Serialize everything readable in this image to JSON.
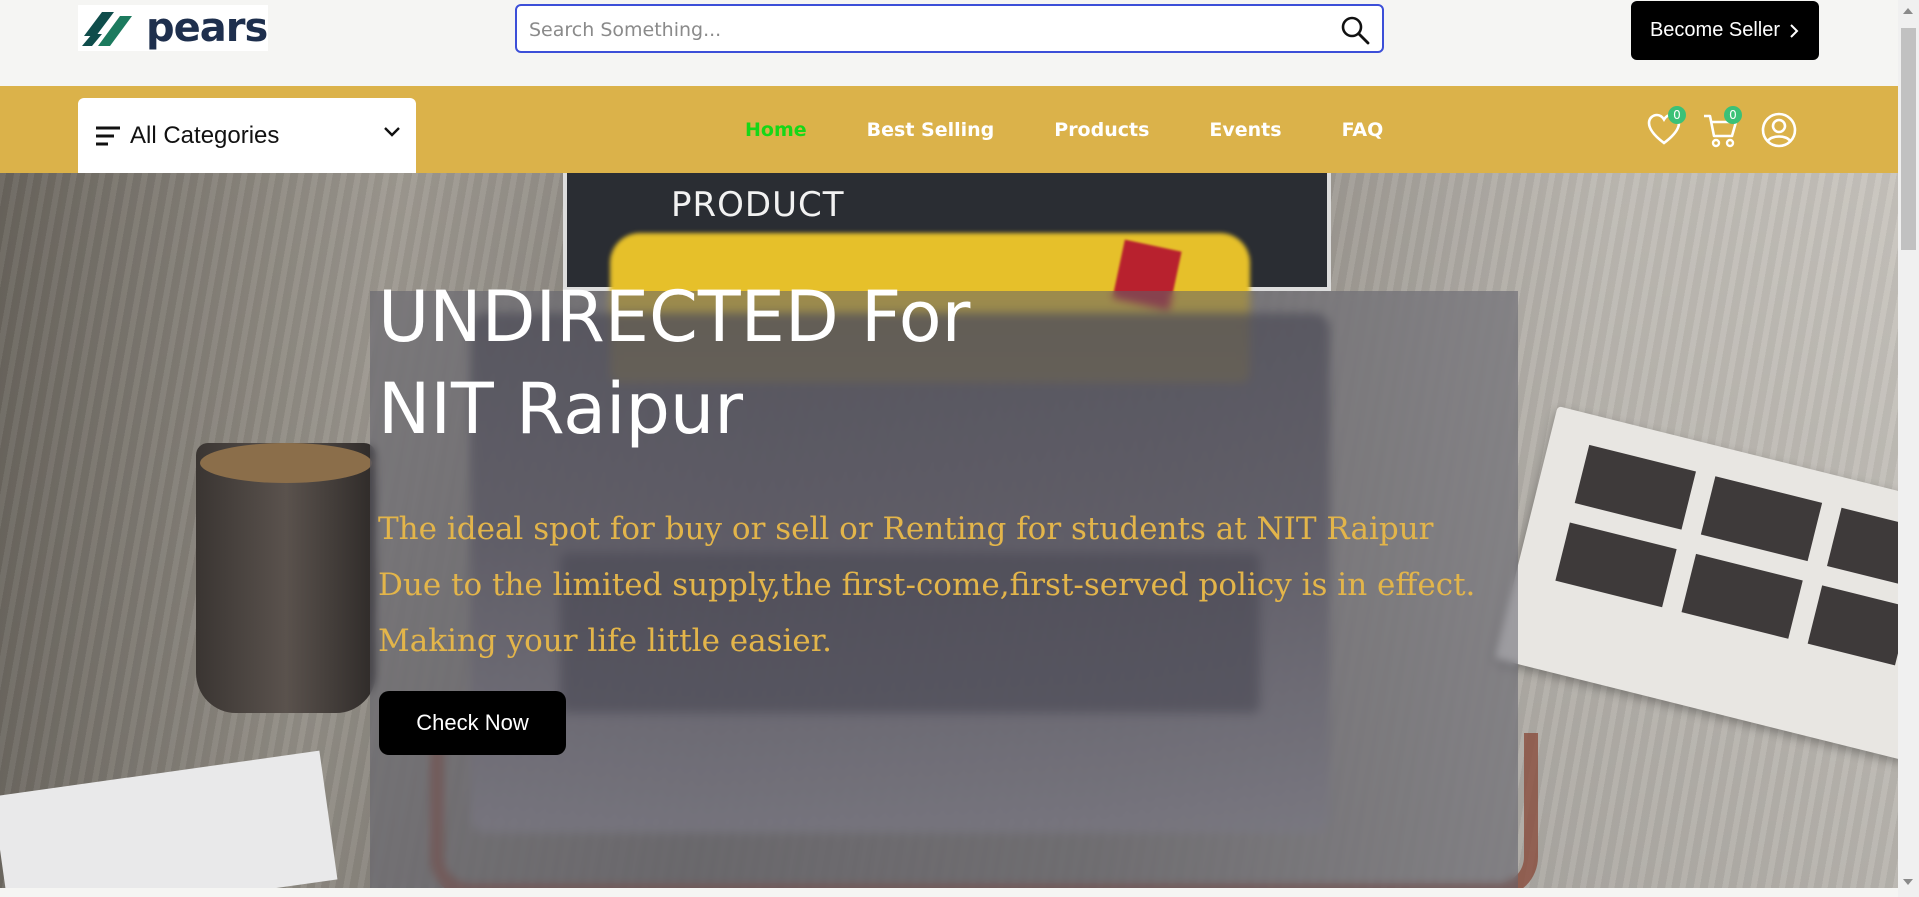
{
  "brand": {
    "name": "pears"
  },
  "search": {
    "placeholder": "Search Something...",
    "value": ""
  },
  "header": {
    "seller_button": "Become Seller"
  },
  "categories": {
    "label": "All Categories"
  },
  "nav": {
    "links": [
      {
        "label": "Home",
        "active": true
      },
      {
        "label": "Best Selling",
        "active": false
      },
      {
        "label": "Products",
        "active": false
      },
      {
        "label": "Events",
        "active": false
      },
      {
        "label": "FAQ",
        "active": false
      }
    ],
    "wishlist_count": "0",
    "cart_count": "0"
  },
  "hero": {
    "background_text": "PRODUCT",
    "title_line1": "UNDIRECTED For",
    "title_line2": "NIT Raipur",
    "subtitle_lines": [
      "The ideal spot for buy or sell or Renting for students at NIT Raipur",
      "Due to the limited supply,the first-come,first-served policy is in effect.",
      "Making your life little easier."
    ],
    "cta": "Check Now"
  },
  "colors": {
    "nav_bg": "#dbb24a",
    "active_link": "#17d717",
    "badge": "#3bc177",
    "search_border": "#3c4fd8",
    "subtitle": "#e3b54a"
  },
  "icons": {
    "logo": "pears-logo-icon",
    "search": "search-icon",
    "seller_chevron": "chevron-right-icon",
    "categories": "menu-lines-icon",
    "categories_chevron": "chevron-down-icon",
    "wishlist": "heart-icon",
    "cart": "cart-icon",
    "profile": "user-circle-icon"
  }
}
